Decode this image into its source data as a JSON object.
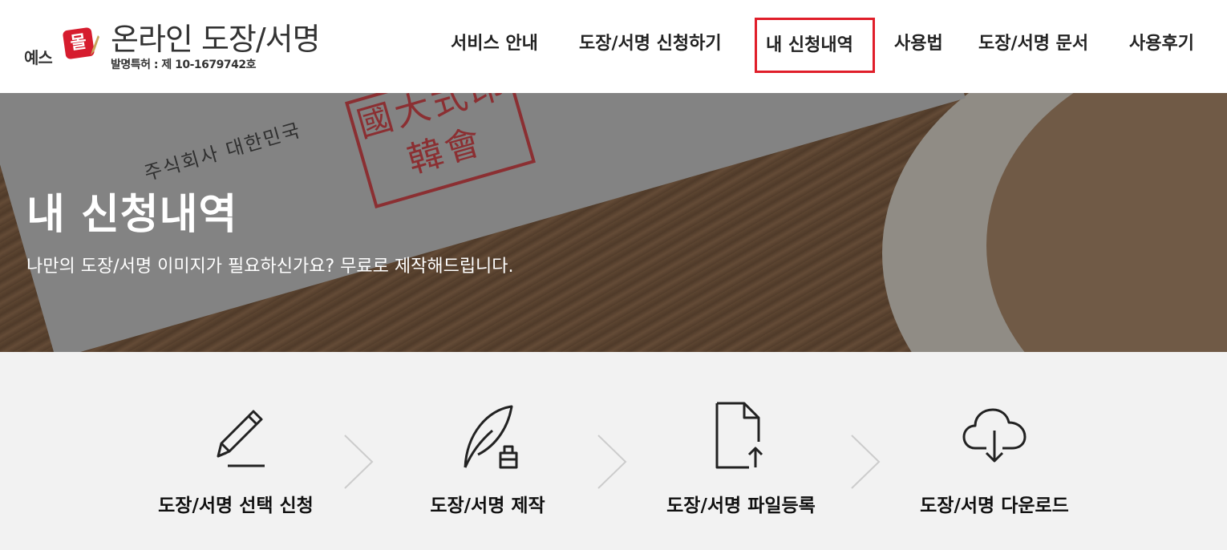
{
  "header": {
    "logo_ye": "예스",
    "logo_seal": "몰",
    "title": "온라인 도장/서명",
    "patent": "발명특허 : 제 10-1679742호"
  },
  "nav": {
    "items": [
      {
        "label": "서비스 안내"
      },
      {
        "label": "도장/서명 신청하기"
      },
      {
        "label": "내 신청내역",
        "active": true
      },
      {
        "label": "사용법"
      },
      {
        "label": "도장/서명 문서"
      },
      {
        "label": "사용후기"
      }
    ]
  },
  "hero": {
    "corp_text": "주식회사 대한민국",
    "stamp_text": "國大式印韓會",
    "title": "내 신청내역",
    "subtitle": "나만의 도장/서명 이미지가 필요하신가요? 무료로 제작해드립니다."
  },
  "steps": [
    {
      "label": "도장/서명 선택 신청",
      "icon": "pencil-icon"
    },
    {
      "label": "도장/서명 제작",
      "icon": "quill-ink-icon"
    },
    {
      "label": "도장/서명 파일등록",
      "icon": "file-upload-icon"
    },
    {
      "label": "도장/서명 다운로드",
      "icon": "cloud-download-icon"
    }
  ],
  "colors": {
    "accent_red": "#e01e2a",
    "stamp_red": "#b5282d"
  }
}
